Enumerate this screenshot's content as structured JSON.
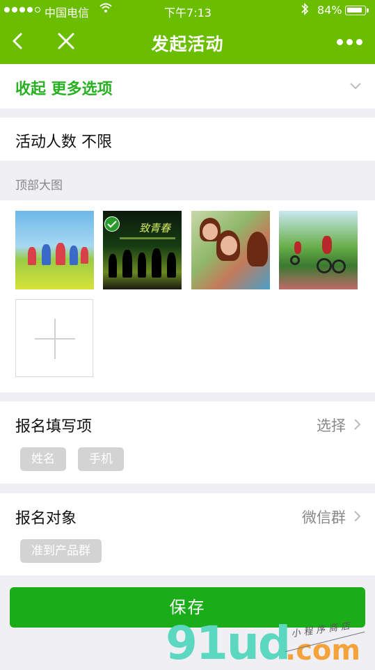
{
  "status_bar": {
    "carrier": "中国电信",
    "time": "下午7:13",
    "battery_pct": "84%",
    "battery_level": 0.84,
    "signal_bars": 4
  },
  "nav": {
    "title": "发起活动",
    "back_icon": "chevron-left-icon",
    "close_icon": "close-icon",
    "more_icon": "more-dots-icon"
  },
  "options": {
    "collapse_label": "收起 更多选项"
  },
  "people": {
    "label": "活动人数 不限"
  },
  "top_image": {
    "header": "顶部大图",
    "thumbnails": [
      {
        "name": "kids-running-meadow",
        "selected": false
      },
      {
        "name": "youth-silhouettes",
        "selected": true,
        "caption": "致青春"
      },
      {
        "name": "friends-picnic",
        "selected": false
      },
      {
        "name": "cyclists-park",
        "selected": false
      }
    ],
    "add_icon": "plus-icon"
  },
  "signup_fields": {
    "label": "报名填写项",
    "action": "选择",
    "tags": [
      "姓名",
      "手机"
    ]
  },
  "signup_target": {
    "label": "报名对象",
    "value": "微信群",
    "tags": [
      "准到产品群"
    ]
  },
  "save_button": {
    "label": "保存"
  },
  "watermark": {
    "brand": "91ud",
    "domain": ".com",
    "tagline": "小程序商店"
  },
  "colors": {
    "header_green": "#6bbd00",
    "button_green": "#1aad19",
    "link_green": "#27b01f"
  }
}
